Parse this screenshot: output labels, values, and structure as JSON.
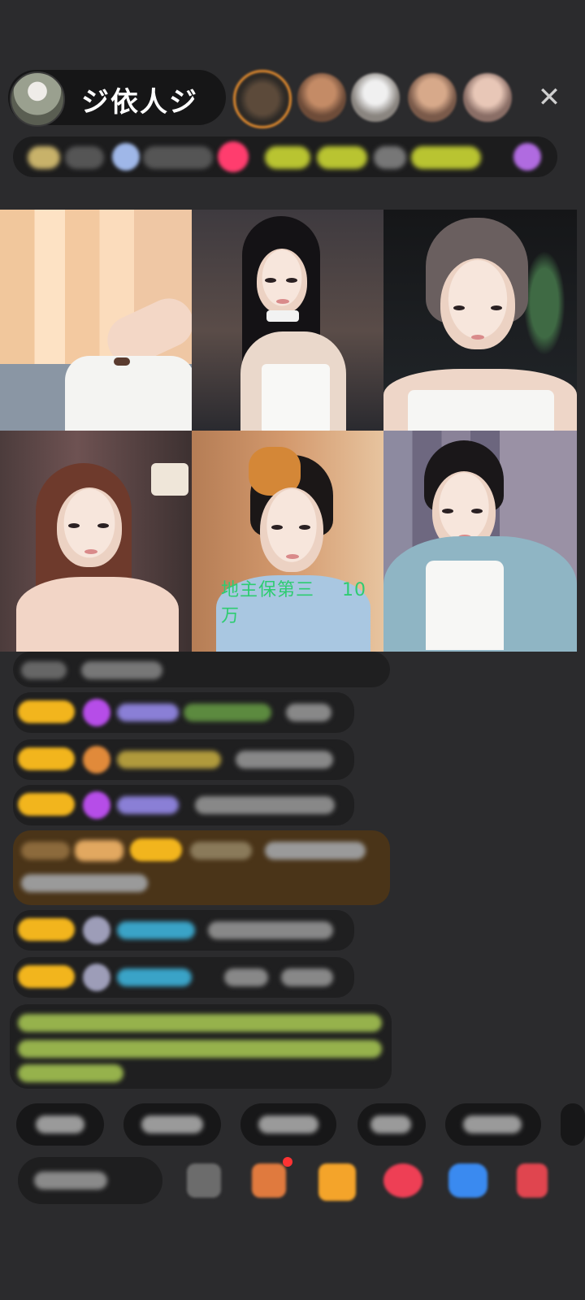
{
  "header": {
    "host_name": "ジ依人ジ",
    "close_icon": "close-icon"
  },
  "grid": {
    "caption_left": "地主保第三",
    "caption_right": "10万"
  },
  "colors": {
    "caption_green": "#2ecc71",
    "badge_yellow": "#f2b51d",
    "host_pill": "#161617"
  }
}
